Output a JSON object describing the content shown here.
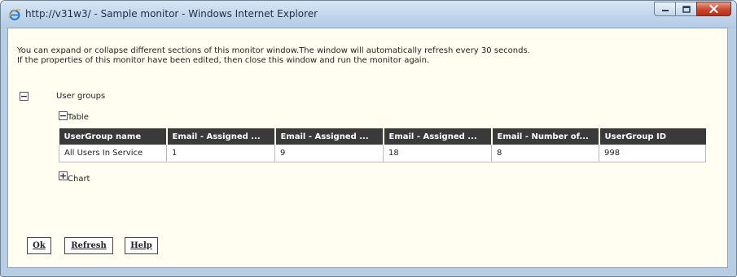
{
  "window": {
    "title": "http://v31w3/ - Sample monitor - Windows Internet Explorer",
    "browser_icon": "internet-explorer-icon",
    "caption_buttons": [
      "minimize-icon",
      "maximize-icon",
      "close-icon"
    ]
  },
  "info": {
    "line1": "You can expand or collapse different sections of this monitor window.The window will automatically refresh every 30 seconds.",
    "line2": "If the properties of this monitor have been edited, then close this window and run the monitor again."
  },
  "section": {
    "toggle_symbol": "−",
    "label": "User groups",
    "table_toggle_symbol": "−",
    "table_label": "Table",
    "chart_toggle_symbol": "+",
    "chart_label": "Chart"
  },
  "table": {
    "columns": [
      "UserGroup name",
      "Email - Assigned ...",
      "Email - Assigned ...",
      "Email - Assigned ...",
      "Email - Number of...",
      "UserGroup ID"
    ],
    "rows": [
      [
        "All Users In Service",
        "1",
        "9",
        "18",
        "8",
        "998"
      ]
    ]
  },
  "buttons": {
    "ok": "Ok",
    "refresh": "Refresh",
    "help": "Help"
  },
  "colors": {
    "header_bg": "#3a3a3a",
    "content_bg": "#fffef0",
    "close_button": "#c9462c"
  }
}
